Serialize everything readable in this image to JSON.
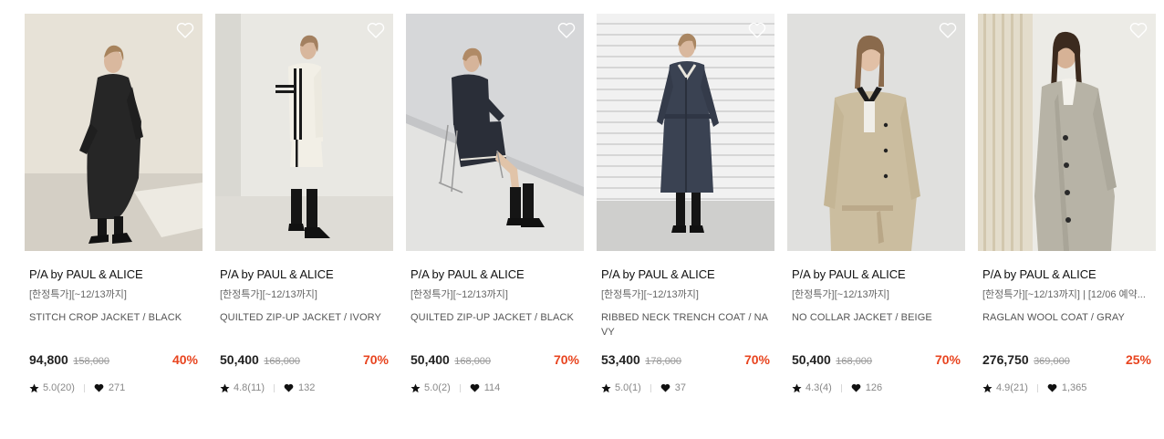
{
  "products": [
    {
      "brand": "P/A by PAUL & ALICE",
      "promo": "[한정특가][~12/13까지]",
      "name": "STITCH CROP JACKET / BLACK",
      "price": "94,800",
      "original_price": "158,000",
      "discount": "40%",
      "rating": "5.0(20)",
      "likes": "271",
      "image": "model-black-stitch-jacket"
    },
    {
      "brand": "P/A by PAUL & ALICE",
      "promo": "[한정특가][~12/13까지]",
      "name": "QUILTED ZIP-UP JACKET / IVORY",
      "price": "50,400",
      "original_price": "168,000",
      "discount": "70%",
      "rating": "4.8(11)",
      "likes": "132",
      "image": "model-ivory-quilted-jacket"
    },
    {
      "brand": "P/A by PAUL & ALICE",
      "promo": "[한정특가][~12/13까지]",
      "name": "QUILTED ZIP-UP JACKET / BLACK",
      "price": "50,400",
      "original_price": "168,000",
      "discount": "70%",
      "rating": "5.0(2)",
      "likes": "114",
      "image": "model-black-quilted-jacket-seated"
    },
    {
      "brand": "P/A by PAUL & ALICE",
      "promo": "[한정특가][~12/13까지]",
      "name": "RIBBED NECK TRENCH COAT / NAVY",
      "price": "53,400",
      "original_price": "178,000",
      "discount": "70%",
      "rating": "5.0(1)",
      "likes": "37",
      "image": "model-navy-trench-coat"
    },
    {
      "brand": "P/A by PAUL & ALICE",
      "promo": "[한정특가][~12/13까지]",
      "name": "NO COLLAR JACKET / BEIGE",
      "price": "50,400",
      "original_price": "168,000",
      "discount": "70%",
      "rating": "4.3(4)",
      "likes": "126",
      "image": "model-beige-no-collar-jacket"
    },
    {
      "brand": "P/A by PAUL & ALICE",
      "promo": "[한정특가][~12/13까지] | [12/06 예약...",
      "name": "RAGLAN WOOL COAT / GRAY",
      "price": "276,750",
      "original_price": "369,000",
      "discount": "25%",
      "rating": "4.9(21)",
      "likes": "1,365",
      "image": "model-gray-raglan-wool-coat"
    }
  ],
  "colors": {
    "discount": "#e8441f",
    "text": "#222222",
    "muted": "#888888"
  },
  "icons": {
    "wishlist": "heart-outline-icon",
    "rating": "star-icon",
    "likes": "heart-filled-icon"
  }
}
